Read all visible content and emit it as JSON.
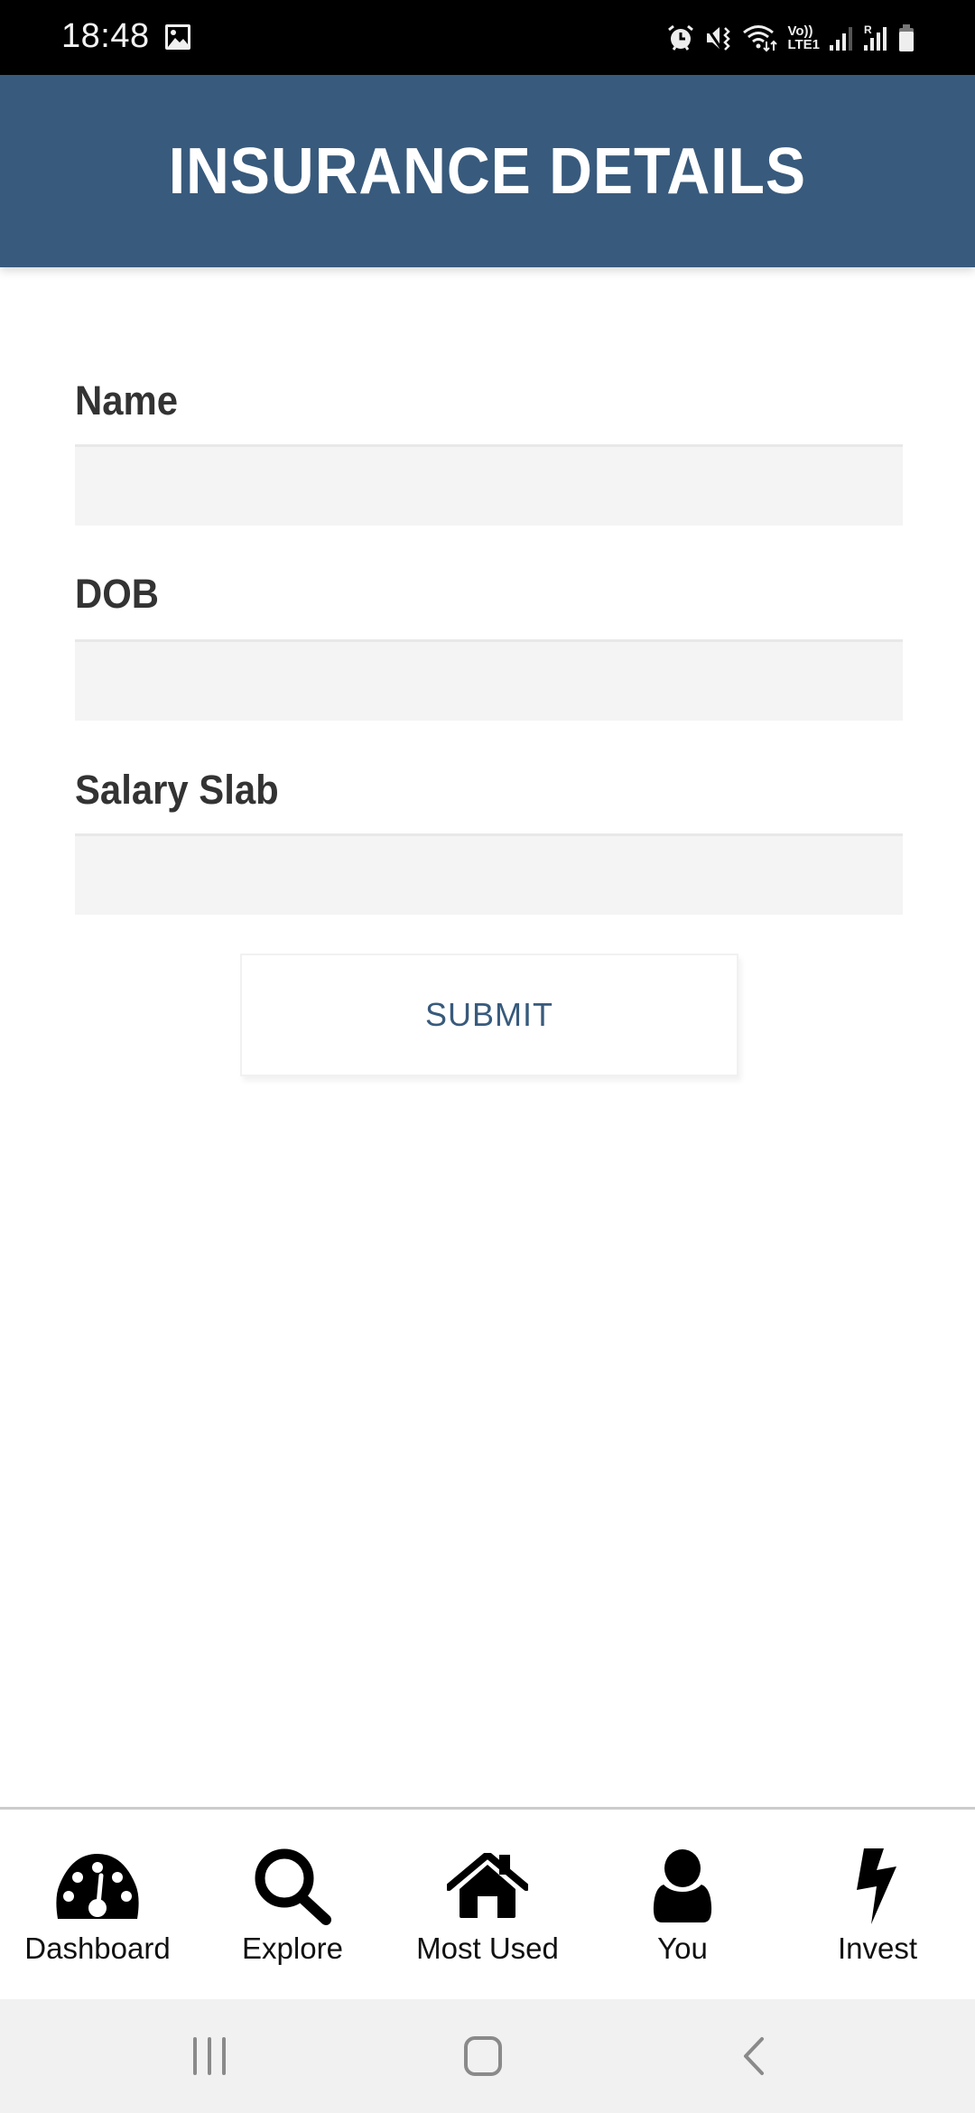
{
  "status_bar": {
    "time": "18:48",
    "left_icons": [
      "gallery-icon"
    ],
    "right_icons": [
      "alarm-icon",
      "vibrate-mute-icon",
      "wifi-icon",
      "volte-lte1-indicator",
      "signal-sim1-icon",
      "roaming-signal-sim2-icon",
      "battery-icon"
    ],
    "volte_label_top": "Vo))",
    "volte_label_bottom": "LTE1",
    "roaming_label": "R"
  },
  "header": {
    "title": "INSURANCE DETAILS",
    "background_color": "#385a7c"
  },
  "form": {
    "fields": [
      {
        "label": "Name",
        "value": "",
        "placeholder": ""
      },
      {
        "label": "DOB",
        "value": "",
        "placeholder": ""
      },
      {
        "label": "Salary Slab",
        "value": "",
        "placeholder": ""
      }
    ],
    "submit_label": "SUBMIT"
  },
  "bottom_nav": {
    "items": [
      {
        "label": "Dashboard",
        "icon": "dashboard-gauge-icon"
      },
      {
        "label": "Explore",
        "icon": "search-icon"
      },
      {
        "label": "Most Used",
        "icon": "home-icon"
      },
      {
        "label": "You",
        "icon": "user-icon"
      },
      {
        "label": "Invest",
        "icon": "lightning-icon"
      }
    ]
  },
  "system_nav": {
    "buttons": [
      "recent-apps",
      "home",
      "back"
    ]
  }
}
